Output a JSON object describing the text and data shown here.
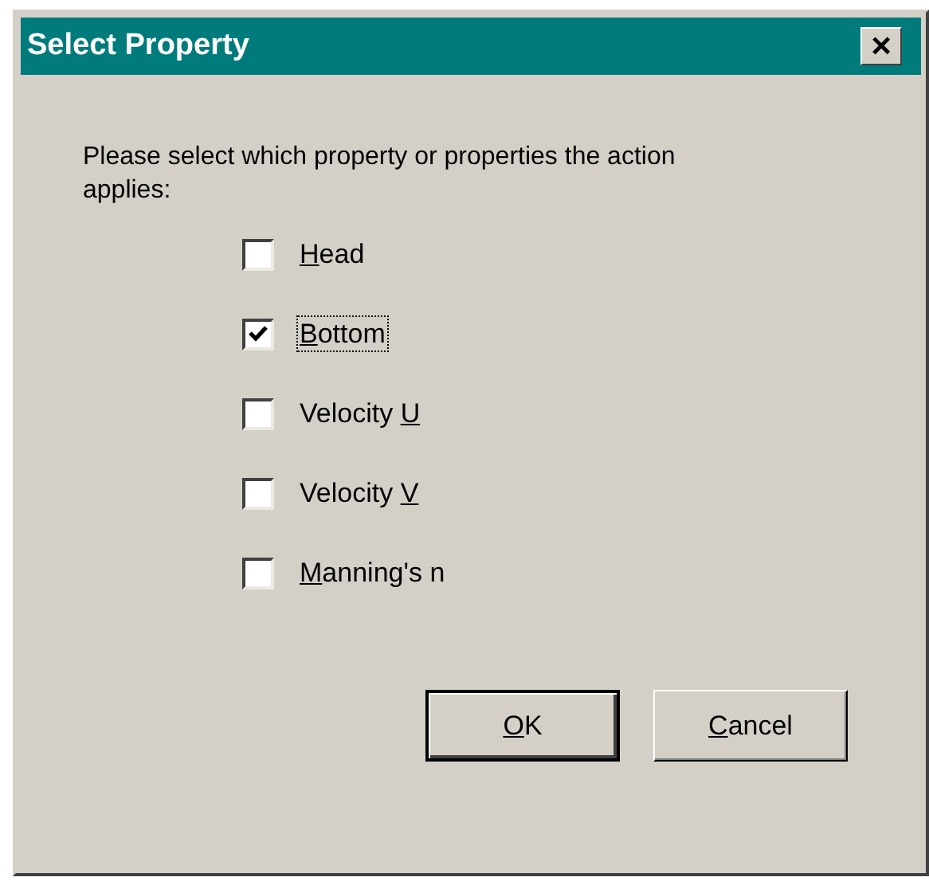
{
  "window": {
    "title": "Select Property",
    "close": "×"
  },
  "prompt": "Please select which property or properties the action applies:",
  "options": [
    {
      "label": {
        "key": "H",
        "post": "ead"
      },
      "checked": false,
      "focused": false
    },
    {
      "label": {
        "key": "B",
        "post": "ottom"
      },
      "checked": true,
      "focused": true
    },
    {
      "label": {
        "pre": "Velocity ",
        "key": "U"
      },
      "checked": false,
      "focused": false
    },
    {
      "label": {
        "pre": "Velocity ",
        "key": "V"
      },
      "checked": false,
      "focused": false
    },
    {
      "label": {
        "key": "M",
        "post": "anning's n"
      },
      "checked": false,
      "focused": false
    }
  ],
  "buttons": [
    {
      "label": {
        "key": "O",
        "post": "K"
      },
      "kind": "default"
    },
    {
      "label": {
        "key": "C",
        "post": "ancel"
      },
      "kind": "normal"
    }
  ]
}
